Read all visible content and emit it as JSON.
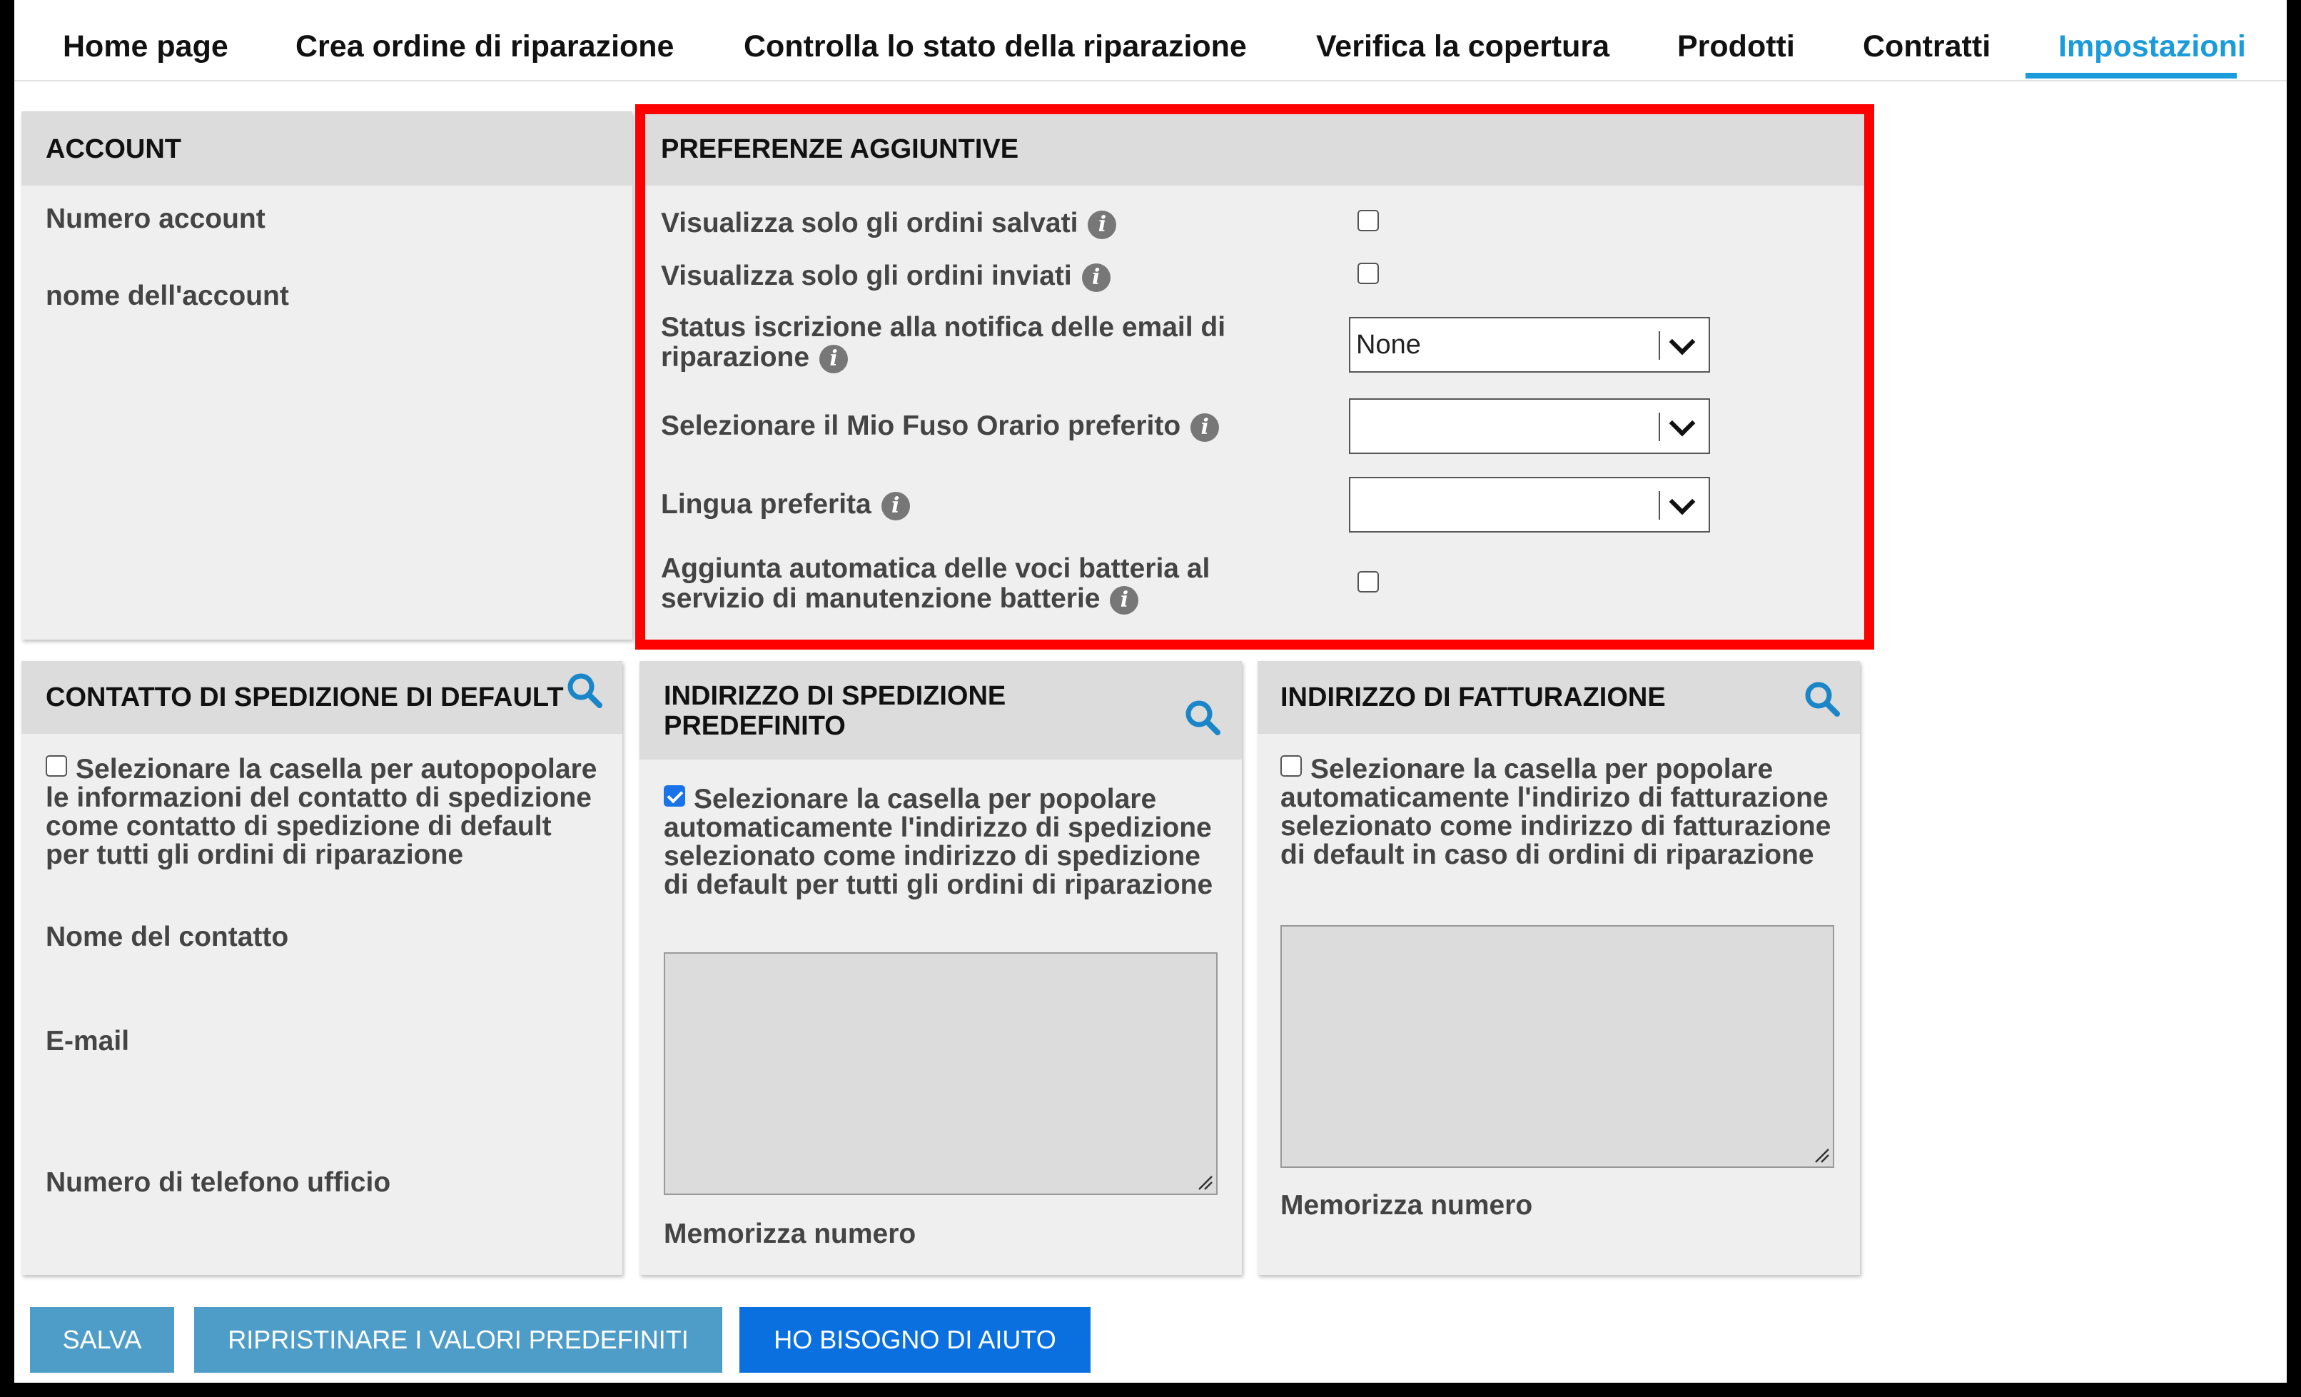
{
  "nav": {
    "tabs": [
      {
        "label": "Home page"
      },
      {
        "label": "Crea ordine di riparazione"
      },
      {
        "label": "Controlla lo stato della riparazione"
      },
      {
        "label": "Verifica la copertura"
      },
      {
        "label": "Prodotti"
      },
      {
        "label": "Contratti"
      },
      {
        "label": "Impostazioni"
      }
    ],
    "active_tab": "Impostazioni"
  },
  "account": {
    "header": "ACCOUNT",
    "fields": [
      {
        "label": "Numero account"
      },
      {
        "label": "nome dell'account"
      }
    ]
  },
  "preferences": {
    "header": "PREFERENZE AGGIUNTIVE",
    "rows": [
      {
        "label": "Visualizza solo gli ordini salvati",
        "control": "checkbox",
        "checked": false
      },
      {
        "label": "Visualizza solo gli ordini inviati",
        "control": "checkbox",
        "checked": false
      },
      {
        "label": "Status iscrizione alla notifica delle email di riparazione",
        "control": "select",
        "value": "None"
      },
      {
        "label": "Selezionare il Mio Fuso Orario preferito",
        "control": "select",
        "value": ""
      },
      {
        "label": "Lingua preferita",
        "control": "select",
        "value": ""
      },
      {
        "label": "Aggiunta automatica delle voci batteria al servizio di manutenzione batterie",
        "control": "checkbox",
        "checked": false
      }
    ]
  },
  "shipping_contact": {
    "header": "CONTATTO DI SPEDIZIONE DI DEFAULT",
    "checkbox_text": "Selezionare la casella per autopopolare le informazioni del contatto di spedizione come contatto di spedizione di default per tutti gli ordini di riparazione",
    "checked": false,
    "fields": [
      {
        "label": "Nome del contatto"
      },
      {
        "label": "E-mail"
      },
      {
        "label": "Numero di telefono ufficio"
      }
    ]
  },
  "shipping_address": {
    "header": "INDIRIZZO DI SPEDIZIONE PREDEFINITO",
    "checkbox_text": "Selezionare la casella per popolare automaticamente l'indirizzo di spedizione selezionato come indirizzo di spedizione di default per tutti gli ordini di riparazione",
    "checked": true,
    "store_number_label": "Memorizza numero"
  },
  "billing_address": {
    "header": "INDIRIZZO DI FATTURAZIONE",
    "checkbox_text": "Selezionare la casella per popolare automaticamente l'indirizo di fatturazione selezionato come indirizzo di fatturazione di default in caso di ordini di riparazione",
    "checked": false,
    "store_number_label": "Memorizza numero"
  },
  "buttons": {
    "save": "SALVA",
    "reset": "RIPRISTINARE I VALORI PREDEFINITI",
    "help": "HO BISOGNO DI AIUTO"
  },
  "colors": {
    "accent": "#1a9bdc",
    "highlight_border": "#ff0000",
    "primary_button": "#0a70e0",
    "secondary_button": "#4e9cc8",
    "panel_bg": "#efefef",
    "panel_header_bg": "#dcdcdc"
  },
  "icons": [
    "info-icon",
    "search-icon",
    "chevron-down-icon",
    "resize-grip-icon"
  ]
}
